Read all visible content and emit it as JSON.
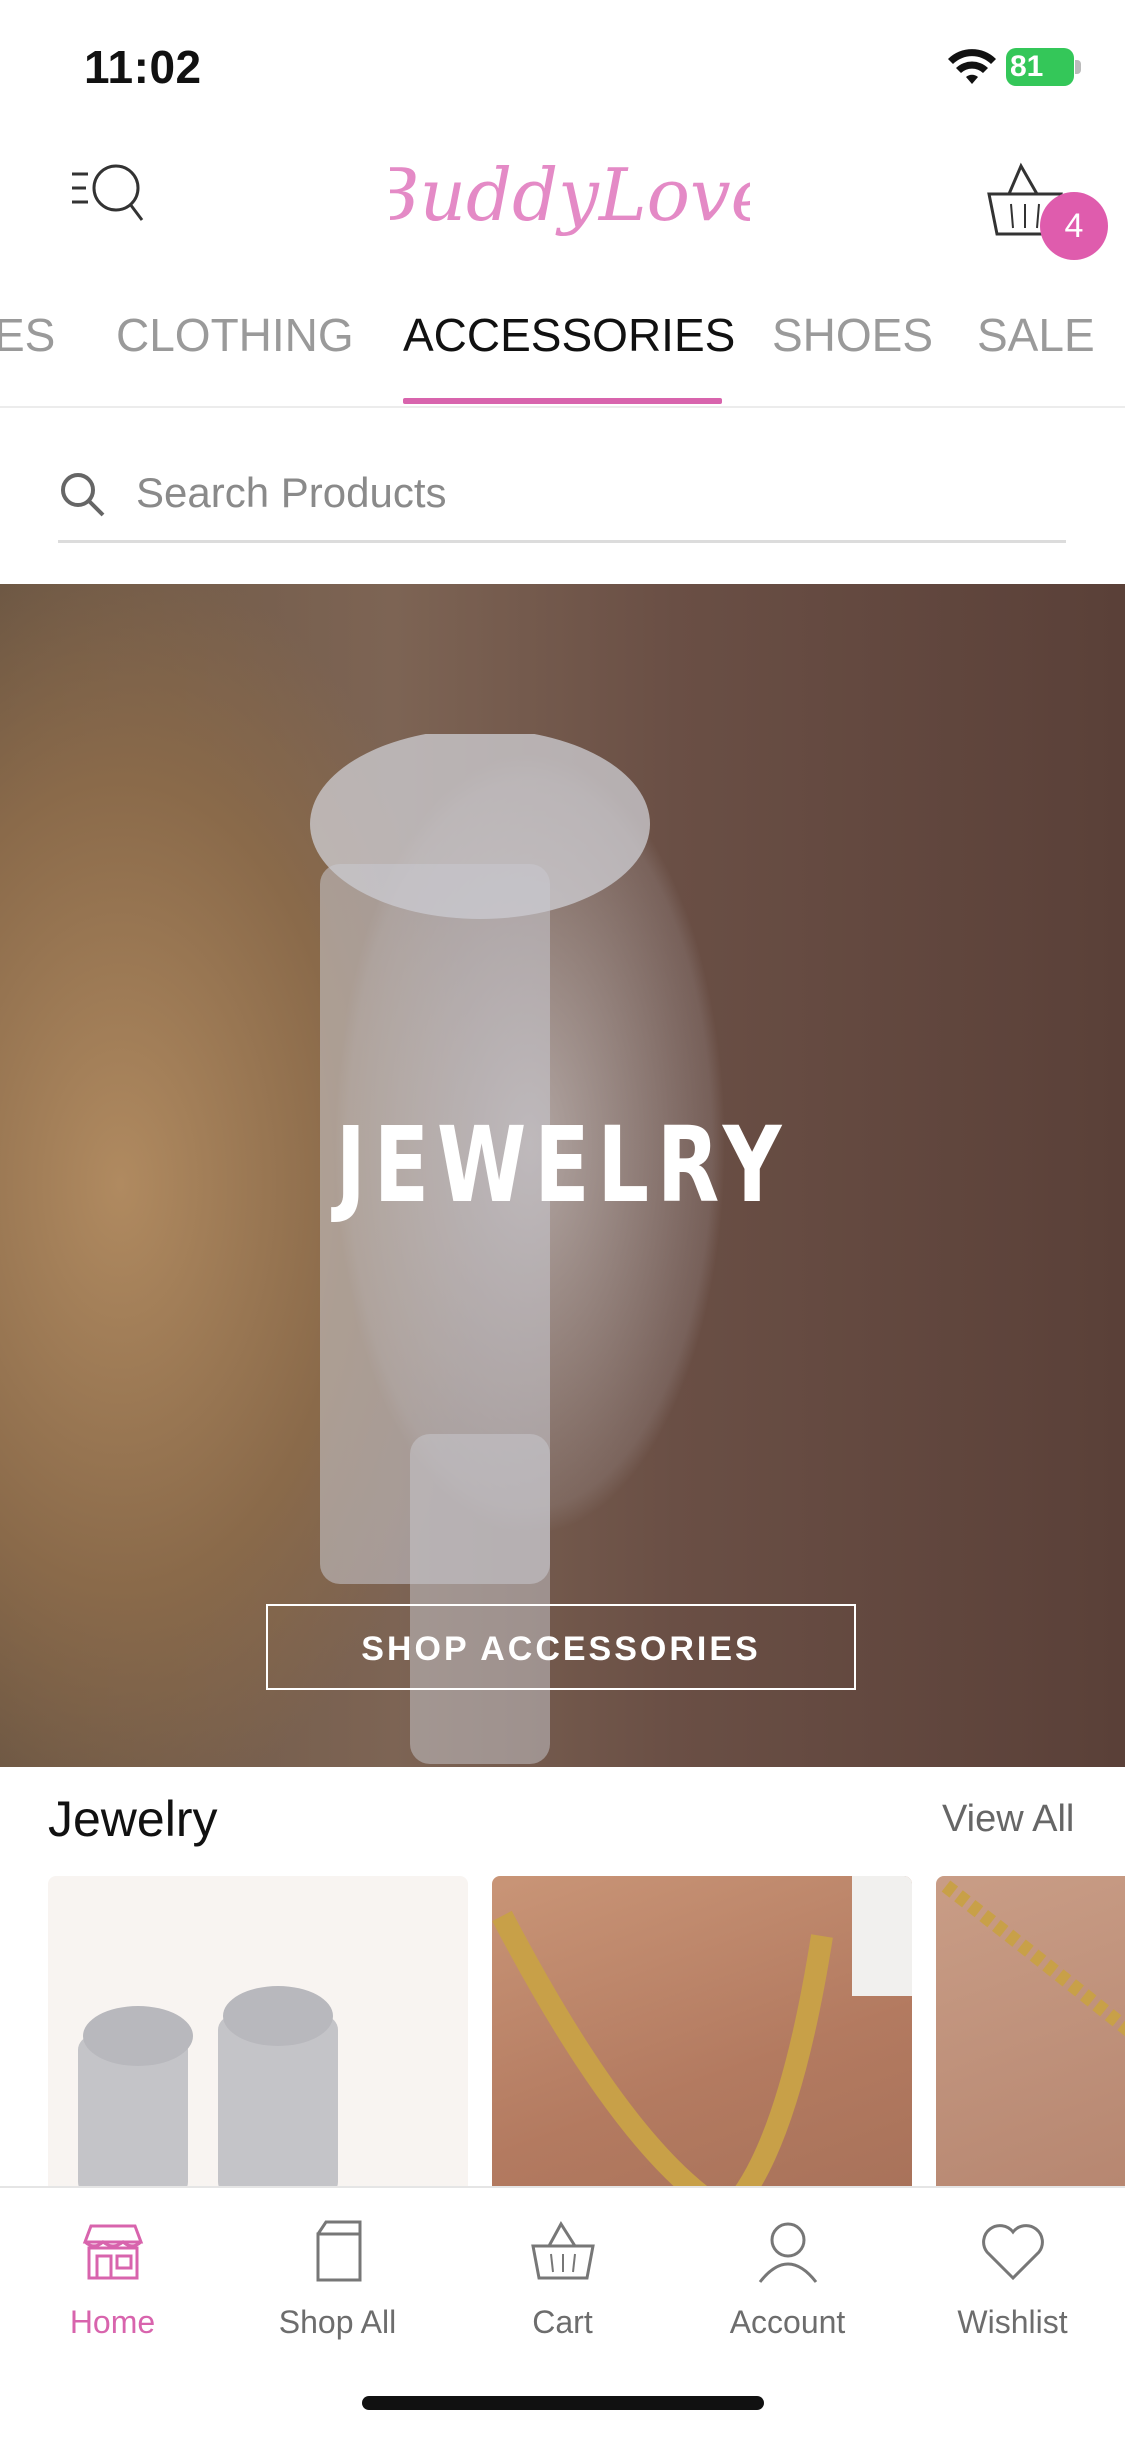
{
  "status_bar": {
    "time": "11:02",
    "battery": "81"
  },
  "header": {
    "logo_text": "BuddyLove",
    "cart_count": "4"
  },
  "tabs": [
    {
      "label": "ES",
      "active": false
    },
    {
      "label": "CLOTHING",
      "active": false
    },
    {
      "label": "ACCESSORIES",
      "active": true
    },
    {
      "label": "SHOES",
      "active": false
    },
    {
      "label": "SALE",
      "active": false
    }
  ],
  "search": {
    "placeholder": "Search Products",
    "value": ""
  },
  "hero": {
    "title": "JEWELRY",
    "button_label": "SHOP ACCESSORIES"
  },
  "section": {
    "title": "Jewelry",
    "view_all": "View All"
  },
  "bottom_nav": [
    {
      "label": "Home",
      "icon": "store-icon",
      "active": true
    },
    {
      "label": "Shop All",
      "icon": "bag-icon",
      "active": false
    },
    {
      "label": "Cart",
      "icon": "basket-icon",
      "active": false
    },
    {
      "label": "Account",
      "icon": "user-icon",
      "active": false
    },
    {
      "label": "Wishlist",
      "icon": "heart-icon",
      "active": false
    }
  ],
  "colors": {
    "accent": "#d864ad",
    "badge": "#df5cad",
    "battery": "#34c759"
  }
}
